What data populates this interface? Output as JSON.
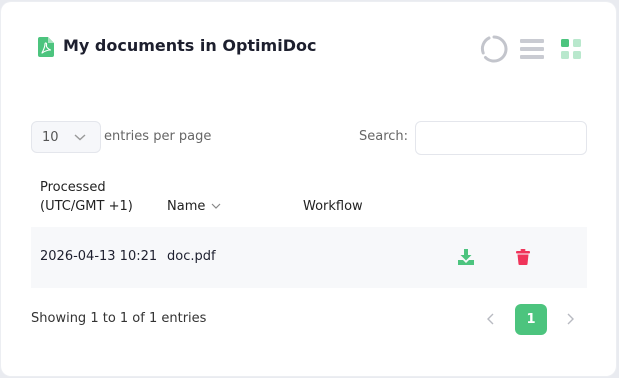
{
  "header": {
    "title": "My documents in OptimiDoc",
    "icons": [
      "pdf-icon",
      "refresh-icon",
      "list-view-icon",
      "grid-view-icon"
    ]
  },
  "controls": {
    "length_value": "10",
    "length_label": "entries per page",
    "search_label": "Search:",
    "search_value": ""
  },
  "table": {
    "columns": [
      "Processed\n(UTC/GMT +1)",
      "Name",
      "Workflow"
    ],
    "rows": [
      {
        "processed": "2026-04-13 10:21",
        "name": "doc.pdf",
        "workflow": ""
      }
    ]
  },
  "footer": {
    "info": "Showing 1 to 1 of 1 entries",
    "current_page": "1"
  },
  "colors": {
    "accent": "#4cc47e",
    "delete": "#f0345a",
    "icon_gray": "#c3c5cc"
  }
}
